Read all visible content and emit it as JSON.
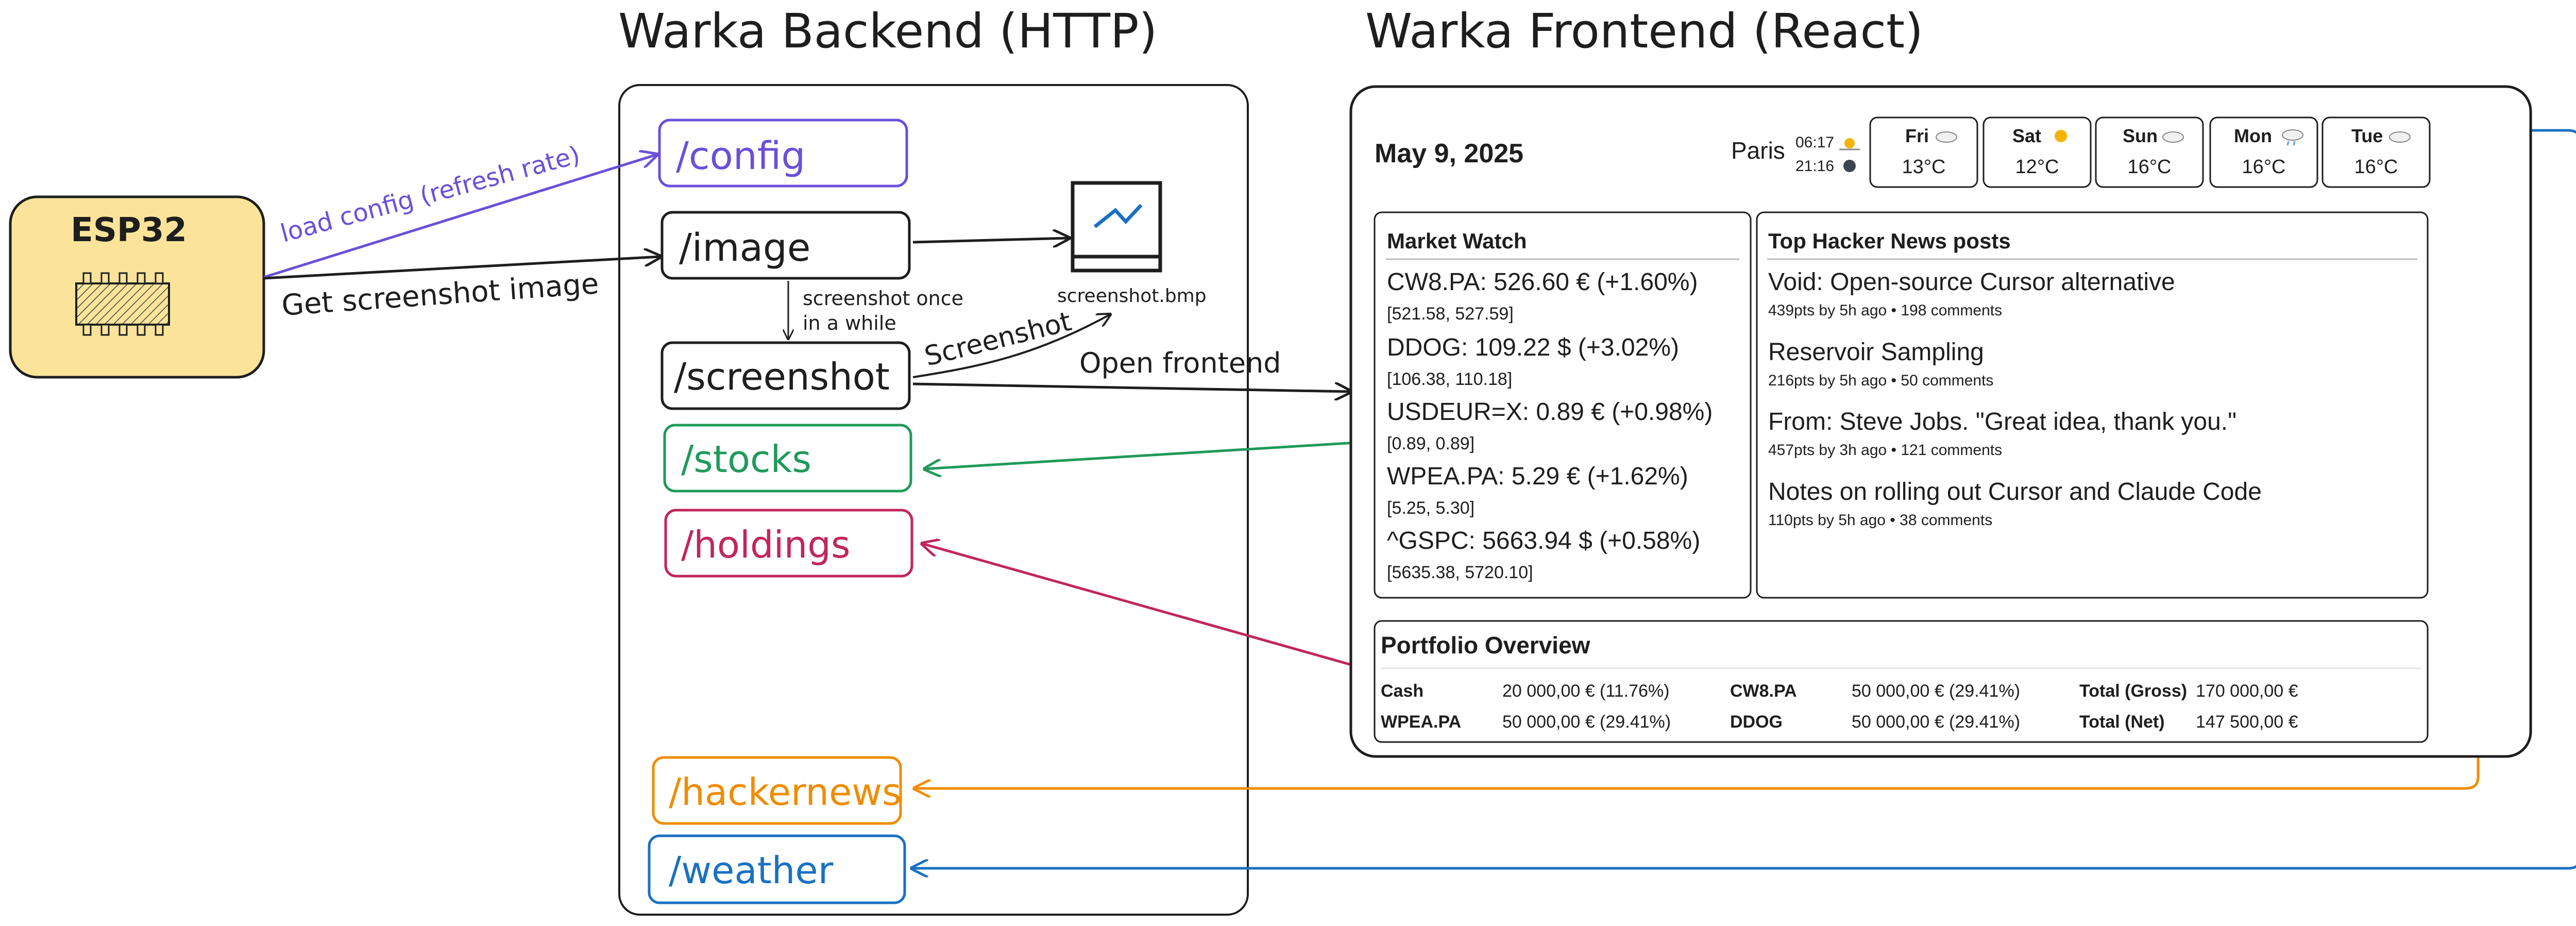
{
  "titles": {
    "backend": "Warka Backend (HTTP)",
    "frontend": "Warka Frontend (React)"
  },
  "device": {
    "label": "ESP32"
  },
  "endpoints": {
    "config": "/config",
    "image": "/image",
    "screenshot": "/screenshot",
    "stocks": "/stocks",
    "holdings": "/holdings",
    "hackernews": "/hackernews",
    "weather": "/weather"
  },
  "file_label": "screenshot.bmp",
  "arrows": {
    "load_config": "load config (refresh rate)",
    "get_image": "Get screenshot image",
    "screenshot_once_1": "screenshot once",
    "screenshot_once_2": "in a while",
    "screenshot": "Screenshot",
    "open_frontend": "Open frontend"
  },
  "colors": {
    "config": "#6a4fdb",
    "stocks": "#1f9a5a",
    "holdings": "#c2255c",
    "hackernews": "#f08c00",
    "weather": "#1971c2",
    "device_fill": "#fbe49a"
  },
  "dashboard": {
    "date": "May 9, 2025",
    "city": "Paris",
    "sunrise": "06:17",
    "sunset": "21:16",
    "forecast": [
      {
        "day": "Fri",
        "icon": "cloud-icon",
        "temp": "13°C"
      },
      {
        "day": "Sat",
        "icon": "sun-icon",
        "temp": "12°C"
      },
      {
        "day": "Sun",
        "icon": "cloud-icon",
        "temp": "16°C"
      },
      {
        "day": "Mon",
        "icon": "snow-cloud-icon",
        "temp": "16°C"
      },
      {
        "day": "Tue",
        "icon": "cloud-icon",
        "temp": "16°C"
      }
    ],
    "market": {
      "title": "Market Watch",
      "items": [
        {
          "line": "CW8.PA: 526.60 € (+1.60%)",
          "range": "[521.58, 527.59]"
        },
        {
          "line": "DDOG: 109.22 $ (+3.02%)",
          "range": "[106.38, 110.18]"
        },
        {
          "line": "USDEUR=X: 0.89 € (+0.98%)",
          "range": "[0.89, 0.89]"
        },
        {
          "line": "WPEA.PA: 5.29 € (+1.62%)",
          "range": "[5.25, 5.30]"
        },
        {
          "line": "^GSPC: 5663.94 $ (+0.58%)",
          "range": "[5635.38, 5720.10]"
        }
      ]
    },
    "hn": {
      "title": "Top Hacker News posts",
      "items": [
        {
          "title": "Void: Open-source Cursor alternative",
          "meta": "439pts by 5h ago • 198 comments"
        },
        {
          "title": "Reservoir Sampling",
          "meta": "216pts by 5h ago • 50 comments"
        },
        {
          "title": "From: Steve Jobs. \"Great idea, thank you.\"",
          "meta": "457pts by 3h ago • 121 comments"
        },
        {
          "title": "Notes on rolling out Cursor and Claude Code",
          "meta": "110pts by 5h ago • 38 comments"
        }
      ]
    },
    "portfolio": {
      "title": "Portfolio Overview",
      "rows": [
        [
          {
            "label": "Cash",
            "value": "20 000,00 € (11.76%)"
          },
          {
            "label": "CW8.PA",
            "value": "50 000,00 € (29.41%)"
          },
          {
            "label": "Total (Gross)",
            "value": "170 000,00 €"
          }
        ],
        [
          {
            "label": "WPEA.PA",
            "value": "50 000,00 € (29.41%)"
          },
          {
            "label": "DDOG",
            "value": "50 000,00 € (29.41%)"
          },
          {
            "label": "Total (Net)",
            "value": "147 500,00 €"
          }
        ]
      ]
    }
  }
}
